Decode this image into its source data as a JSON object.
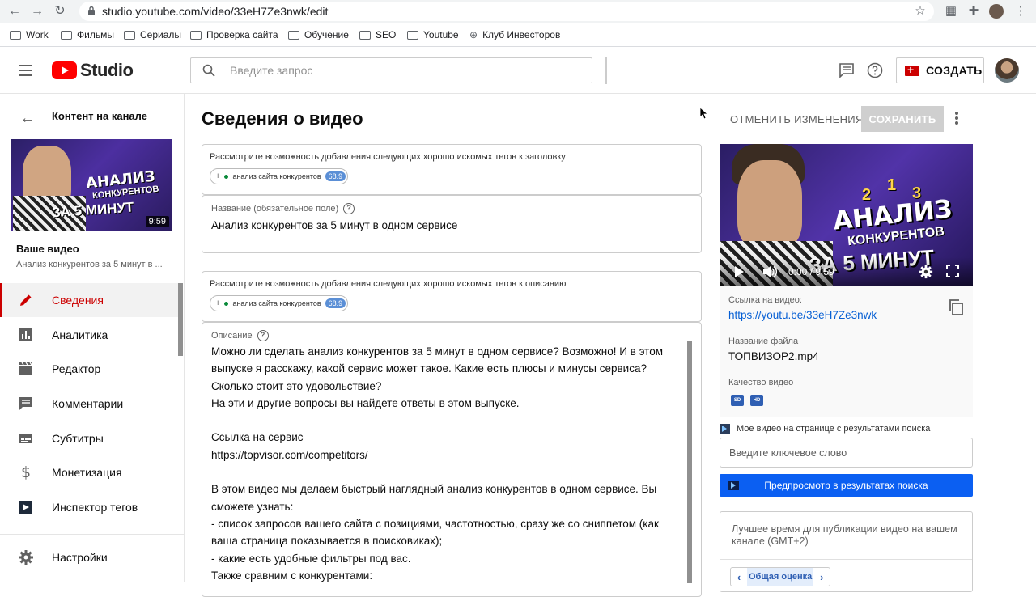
{
  "browser": {
    "url": "studio.youtube.com/video/33eH7Ze3nwk/edit",
    "bookmarks": [
      "Work",
      "Фильмы",
      "Сериалы",
      "Проверка сайта",
      "Обучение",
      "SEO",
      "Youtube",
      "Клуб Инвесторов"
    ]
  },
  "header": {
    "logo_text": "Studio",
    "search_placeholder": "Введите запрос",
    "create_label": "СОЗДАТЬ",
    "brand_color": "#ff0000"
  },
  "sidebar": {
    "back_title": "Контент на канале",
    "thumb_duration": "9:59",
    "thumb_text": [
      "АНАЛИЗ",
      "КОНКУРЕНТОВ",
      "ЗА 5 МИНУТ"
    ],
    "your_video": "Ваше видео",
    "your_video_sub": "Анализ конкурентов за 5 минут в ...",
    "items": [
      {
        "label": "Сведения",
        "icon": "pencil-icon",
        "active": true
      },
      {
        "label": "Аналитика",
        "icon": "analytics-icon",
        "active": false
      },
      {
        "label": "Редактор",
        "icon": "clapperboard-icon",
        "active": false
      },
      {
        "label": "Комментарии",
        "icon": "comment-icon",
        "active": false
      },
      {
        "label": "Субтитры",
        "icon": "subtitles-icon",
        "active": false
      },
      {
        "label": "Монетизация",
        "icon": "dollar-icon",
        "active": false
      },
      {
        "label": "Инспектор тегов",
        "icon": "tag-inspector-icon",
        "active": false
      }
    ],
    "settings_label": "Настройки",
    "active_color": "#cc0000"
  },
  "main": {
    "title": "Сведения о видео",
    "discard_label": "ОТМЕНИТЬ ИЗМЕНЕНИЯ",
    "save_label": "СОХРАНИТЬ",
    "title_hint": "Рассмотрите возможность добавления следующих хорошо искомых тегов к заголовку",
    "desc_hint": "Рассмотрите возможность добавления следующих хорошо искомых тегов к описанию",
    "tag_chip": {
      "label": "анализ сайта конкурентов",
      "score": "68.9"
    },
    "title_field": {
      "label": "Название (обязательное поле)",
      "value": "Анализ конкурентов за 5 минут в одном сервисе"
    },
    "desc_field": {
      "label": "Описание",
      "value": "Можно ли сделать анализ конкурентов за 5 минут в одном сервисе? Возможно! И в этом выпуске я расскажу, какой сервис может такое. Какие есть плюсы и минусы сервиса? Сколько стоит это удовольствие?\nНа эти и другие вопросы вы найдете ответы в этом выпуске.\n\nСсылка на сервис\nhttps://topvisor.com/competitors/\n\nВ этом видео мы делаем быстрый наглядный анализ конкурентов в одном сервисе. Вы сможете узнать:\n- список запросов вашего сайта с позициями, частотностью, сразу же со сниппетом (как ваша страница показывается в поисковиках);\n- какие есть удобные фильтры под вас.\nТакже сравним с конкурентами:"
    }
  },
  "right": {
    "player_time": "0:00 / 9:59",
    "player_text": [
      "АНАЛИЗ",
      "КОНКУРЕНТОВ",
      "ЗА 5 МИНУТ"
    ],
    "player_numbers": [
      "2",
      "1",
      "3"
    ],
    "link_label": "Ссылка на видео:",
    "link_value": "https://youtu.be/33eH7Ze3nwk",
    "file_label": "Название файла",
    "file_value": "ТОПВИЗОР2.mp4",
    "quality_label": "Качество видео",
    "quality_badges": [
      "SD",
      "HD"
    ],
    "kw_title": "Мое видео на странице с результатами поиска",
    "kw_placeholder": "Введите ключевое слово",
    "preview_label": "Предпросмотр в результатах поиска",
    "best_time": "Лучшее время для публикации видео на вашем канале (GMT+2)",
    "rating_label": "Общая оценка",
    "accent": "#0b5ff2"
  }
}
